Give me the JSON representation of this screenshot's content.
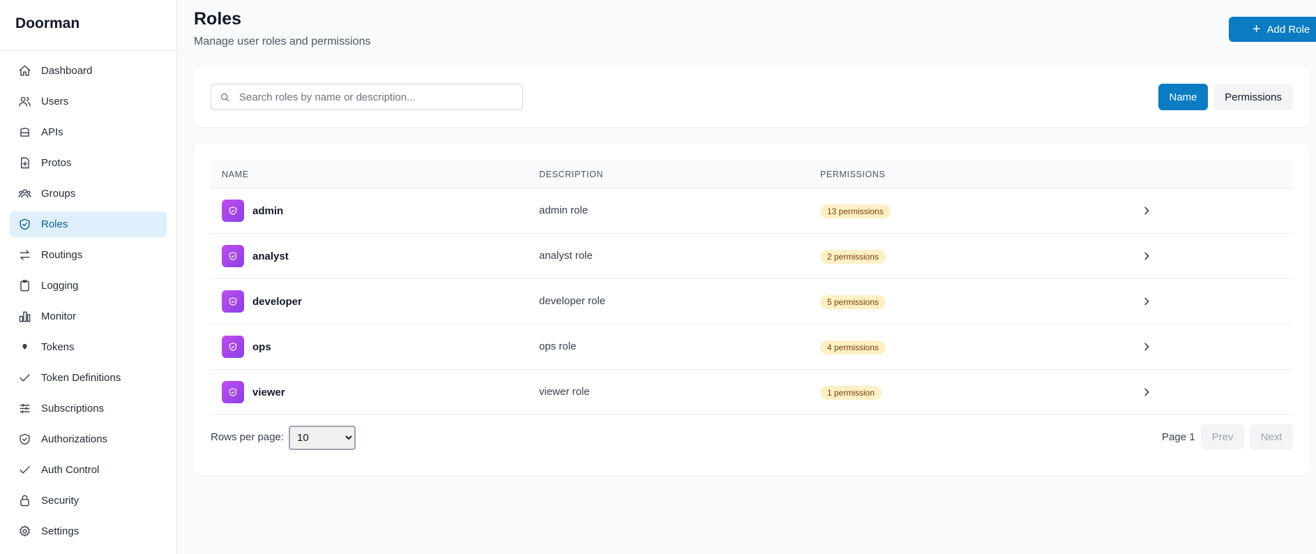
{
  "app": {
    "title": "Doorman"
  },
  "sidebar": {
    "items": [
      {
        "label": "Dashboard",
        "icon": "home-icon",
        "active": false
      },
      {
        "label": "Users",
        "icon": "users-icon",
        "active": false
      },
      {
        "label": "APIs",
        "icon": "database-icon",
        "active": false
      },
      {
        "label": "Protos",
        "icon": "file-plus-icon",
        "active": false
      },
      {
        "label": "Groups",
        "icon": "groups-icon",
        "active": false
      },
      {
        "label": "Roles",
        "icon": "shield-icon",
        "active": true
      },
      {
        "label": "Routings",
        "icon": "arrows-swap-icon",
        "active": false
      },
      {
        "label": "Logging",
        "icon": "clipboard-icon",
        "active": false
      },
      {
        "label": "Monitor",
        "icon": "bar-chart-icon",
        "active": false
      },
      {
        "label": "Tokens",
        "icon": "map-pin-icon",
        "active": false
      },
      {
        "label": "Token Definitions",
        "icon": "check-icon",
        "active": false
      },
      {
        "label": "Subscriptions",
        "icon": "sliders-icon",
        "active": false
      },
      {
        "label": "Authorizations",
        "icon": "shield-check-icon",
        "active": false
      },
      {
        "label": "Auth Control",
        "icon": "check-icon",
        "active": false
      },
      {
        "label": "Security",
        "icon": "lock-icon",
        "active": false
      },
      {
        "label": "Settings",
        "icon": "gear-icon",
        "active": false
      }
    ]
  },
  "header": {
    "title": "Roles",
    "subtitle": "Manage user roles and permissions",
    "add_label": "Add Role"
  },
  "filters": {
    "search_placeholder": "Search roles by name or description...",
    "search_value": "",
    "sort_name_label": "Name",
    "sort_permissions_label": "Permissions"
  },
  "table": {
    "columns": [
      "NAME",
      "DESCRIPTION",
      "PERMISSIONS"
    ],
    "rows": [
      {
        "name": "admin",
        "description": "admin role",
        "permissions": "13 permissions"
      },
      {
        "name": "analyst",
        "description": "analyst role",
        "permissions": "2 permissions"
      },
      {
        "name": "developer",
        "description": "developer role",
        "permissions": "5 permissions"
      },
      {
        "name": "ops",
        "description": "ops role",
        "permissions": "4 permissions"
      },
      {
        "name": "viewer",
        "description": "viewer role",
        "permissions": "1 permission"
      }
    ]
  },
  "pagination": {
    "rows_per_page_label": "Rows per page:",
    "rows_per_page_value": "10",
    "page_label": "Page 1",
    "prev_label": "Prev",
    "next_label": "Next"
  },
  "colors": {
    "accent": "#0b7bc4",
    "active_nav_bg": "#e0effc",
    "badge_bg": "#fdf0c4",
    "role_icon_gradient_start": "#c04ff0",
    "role_icon_gradient_end": "#8b3ee6"
  }
}
